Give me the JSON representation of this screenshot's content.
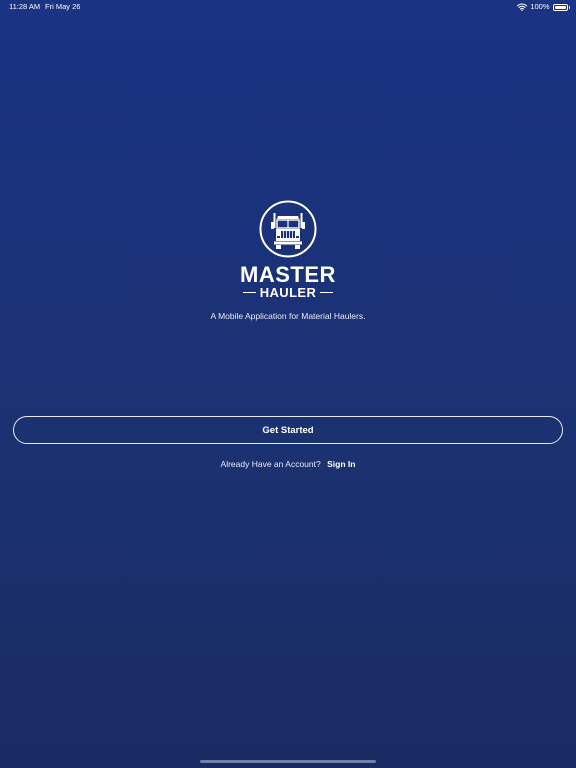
{
  "status_bar": {
    "time": "11:28 AM",
    "date": "Fri May 26",
    "battery_label": "100%",
    "battery_level": 1.0
  },
  "logo": {
    "icon": "truck-icon",
    "wordmark_top": "MASTER",
    "wordmark_bottom": "HAULER"
  },
  "tagline": "A Mobile Application for Material Haulers.",
  "get_started_label": "Get Started",
  "signin": {
    "prompt": "Already Have an Account?",
    "link_label": "Sign In"
  },
  "colors": {
    "background_top": "#1a3383",
    "background_bottom": "#192b62",
    "text": "#ffffff"
  }
}
